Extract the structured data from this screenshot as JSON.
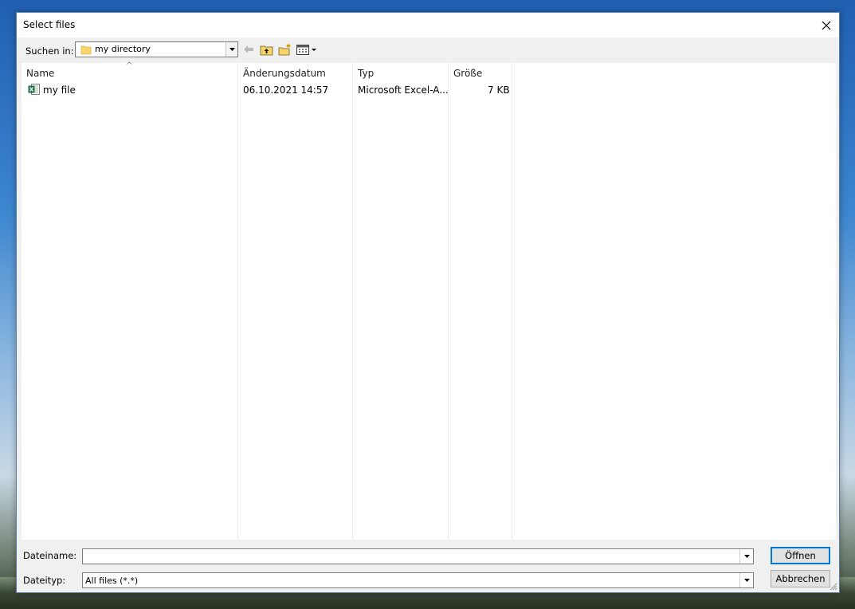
{
  "window": {
    "title": "Select files"
  },
  "toolbar": {
    "look_in_label": "Suchen in:",
    "look_in_value": "my directory"
  },
  "columns": {
    "name": "Name",
    "modified": "Änderungsdatum",
    "type": "Typ",
    "size": "Größe"
  },
  "files": [
    {
      "name": "my file",
      "modified": "06.10.2021 14:57",
      "type": "Microsoft Excel-A...",
      "size": "7 KB"
    }
  ],
  "footer": {
    "filename_label": "Dateiname:",
    "filename_value": "",
    "filetype_label": "Dateityp:",
    "filetype_value": "All files (*.*)",
    "open_label": "Öffnen",
    "cancel_label": "Abbrechen"
  },
  "icons": {
    "close": "close-icon",
    "back": "back-arrow-icon",
    "up": "up-folder-icon",
    "new_folder": "new-folder-icon",
    "view": "view-menu-icon",
    "file": "excel-file-icon"
  },
  "colors": {
    "accent": "#0078d7",
    "folder": "#f9d66b"
  }
}
